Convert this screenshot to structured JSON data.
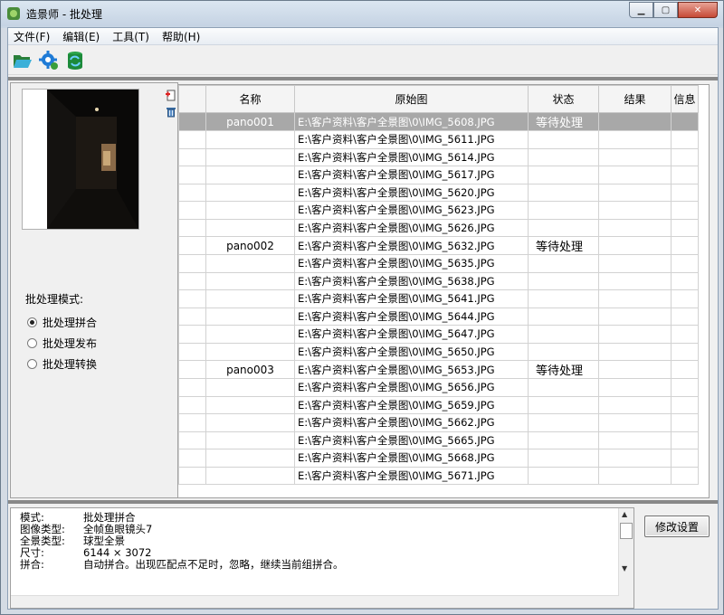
{
  "window": {
    "title": "造景师 - 批处理"
  },
  "menu": [
    "文件(F)",
    "编辑(E)",
    "工具(T)",
    "帮助(H)"
  ],
  "toolbar": [
    {
      "icon": "open-folder-icon"
    },
    {
      "icon": "gear-settings-icon"
    },
    {
      "icon": "database-refresh-icon"
    }
  ],
  "left_panel": {
    "mode_title": "批处理模式:",
    "modes": [
      {
        "label": "批处理拼合",
        "selected": true
      },
      {
        "label": "批处理发布",
        "selected": false
      },
      {
        "label": "批处理转换",
        "selected": false
      }
    ]
  },
  "table": {
    "headers": [
      "",
      "名称",
      "原始图",
      "状态",
      "结果",
      "信息"
    ],
    "rows": [
      {
        "name": "pano001",
        "path": "E:\\客户资料\\客户全景图\\0\\IMG_5608.JPG",
        "status": "等待处理",
        "selected": true
      },
      {
        "name": "",
        "path": "E:\\客户资料\\客户全景图\\0\\IMG_5611.JPG",
        "status": ""
      },
      {
        "name": "",
        "path": "E:\\客户资料\\客户全景图\\0\\IMG_5614.JPG",
        "status": ""
      },
      {
        "name": "",
        "path": "E:\\客户资料\\客户全景图\\0\\IMG_5617.JPG",
        "status": ""
      },
      {
        "name": "",
        "path": "E:\\客户资料\\客户全景图\\0\\IMG_5620.JPG",
        "status": ""
      },
      {
        "name": "",
        "path": "E:\\客户资料\\客户全景图\\0\\IMG_5623.JPG",
        "status": ""
      },
      {
        "name": "",
        "path": "E:\\客户资料\\客户全景图\\0\\IMG_5626.JPG",
        "status": ""
      },
      {
        "name": "pano002",
        "path": "E:\\客户资料\\客户全景图\\0\\IMG_5632.JPG",
        "status": "等待处理"
      },
      {
        "name": "",
        "path": "E:\\客户资料\\客户全景图\\0\\IMG_5635.JPG",
        "status": ""
      },
      {
        "name": "",
        "path": "E:\\客户资料\\客户全景图\\0\\IMG_5638.JPG",
        "status": ""
      },
      {
        "name": "",
        "path": "E:\\客户资料\\客户全景图\\0\\IMG_5641.JPG",
        "status": ""
      },
      {
        "name": "",
        "path": "E:\\客户资料\\客户全景图\\0\\IMG_5644.JPG",
        "status": ""
      },
      {
        "name": "",
        "path": "E:\\客户资料\\客户全景图\\0\\IMG_5647.JPG",
        "status": ""
      },
      {
        "name": "",
        "path": "E:\\客户资料\\客户全景图\\0\\IMG_5650.JPG",
        "status": ""
      },
      {
        "name": "pano003",
        "path": "E:\\客户资料\\客户全景图\\0\\IMG_5653.JPG",
        "status": "等待处理"
      },
      {
        "name": "",
        "path": "E:\\客户资料\\客户全景图\\0\\IMG_5656.JPG",
        "status": ""
      },
      {
        "name": "",
        "path": "E:\\客户资料\\客户全景图\\0\\IMG_5659.JPG",
        "status": ""
      },
      {
        "name": "",
        "path": "E:\\客户资料\\客户全景图\\0\\IMG_5662.JPG",
        "status": ""
      },
      {
        "name": "",
        "path": "E:\\客户资料\\客户全景图\\0\\IMG_5665.JPG",
        "status": ""
      },
      {
        "name": "",
        "path": "E:\\客户资料\\客户全景图\\0\\IMG_5668.JPG",
        "status": ""
      },
      {
        "name": "",
        "path": "E:\\客户资料\\客户全景图\\0\\IMG_5671.JPG",
        "status": ""
      }
    ]
  },
  "info": [
    {
      "key": "模式:",
      "value": "批处理拼合"
    },
    {
      "key": "图像类型:",
      "value": "全帧鱼眼镜头7"
    },
    {
      "key": "全景类型:",
      "value": "球型全景"
    },
    {
      "key": "尺寸:",
      "value": "6144 × 3072"
    },
    {
      "key": "拼合:",
      "value": "自动拼合。出现匹配点不足时，忽略，继续当前组拼合。"
    }
  ],
  "buttons": {
    "modify": "修改设置"
  },
  "colors": {
    "selected_row": "#a8a8a8",
    "title_bar": "#c9d6e4",
    "close_button": "#c64a36"
  }
}
